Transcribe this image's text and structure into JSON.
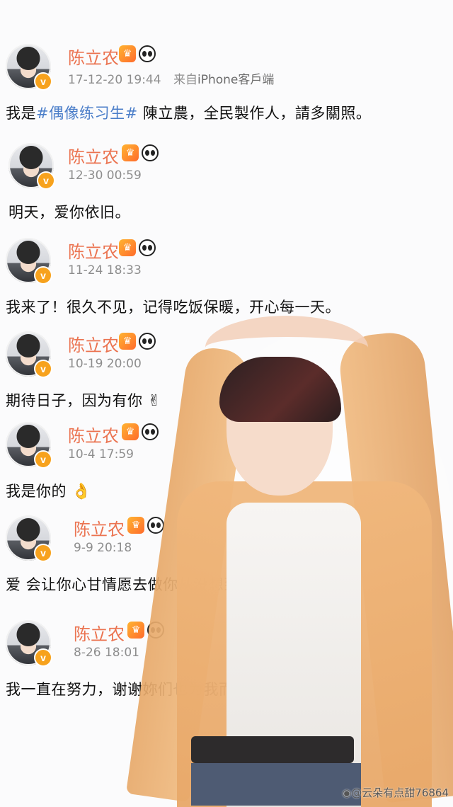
{
  "posts": [
    {
      "username": "陈立农",
      "time": "17-12-20 19:44",
      "source_prefix": "来自",
      "source": "iPhone客戶端",
      "text_before": "我是",
      "hashtag": "#偶像练习生#",
      "text_after": " 陳立農，全民製作人，請多關照。"
    },
    {
      "username": "陈立农",
      "time": "12-30 00:59",
      "text": "明天，爱你依旧。"
    },
    {
      "username": "陈立农",
      "time": "11-24 18:33",
      "text": "我来了！很久不见，记得吃饭保暖，开心每一天。"
    },
    {
      "username": "陈立农",
      "time": "10-19 20:00",
      "text": "期待日子，因为有你",
      "emoji": "✌"
    },
    {
      "username": "陈立农",
      "time": "10-4 17:59",
      "text": "我是你的",
      "emoji": "👌"
    },
    {
      "username": "陈立农",
      "time": "9-9 20:18",
      "text": "爱 会让你心甘情愿去做你从没想到的事。"
    },
    {
      "username": "陈立农",
      "time": "8-26 18:01",
      "text": "我一直在努力，谢谢妳们也为我而努力。"
    }
  ],
  "badges": {
    "verified": "v",
    "crown": "♛"
  },
  "icons": {
    "verified": "verified-badge-icon",
    "crown": "crown-icon",
    "panda": "panda-icon",
    "weibo": "weibo-logo-icon"
  },
  "colors": {
    "username": "#eb7350",
    "hashtag": "#4b7ec9",
    "meta": "#8d8d8d",
    "verified": "#f7a21d"
  },
  "watermark": {
    "logo": "◉",
    "text": "@云朵有点甜76864"
  }
}
